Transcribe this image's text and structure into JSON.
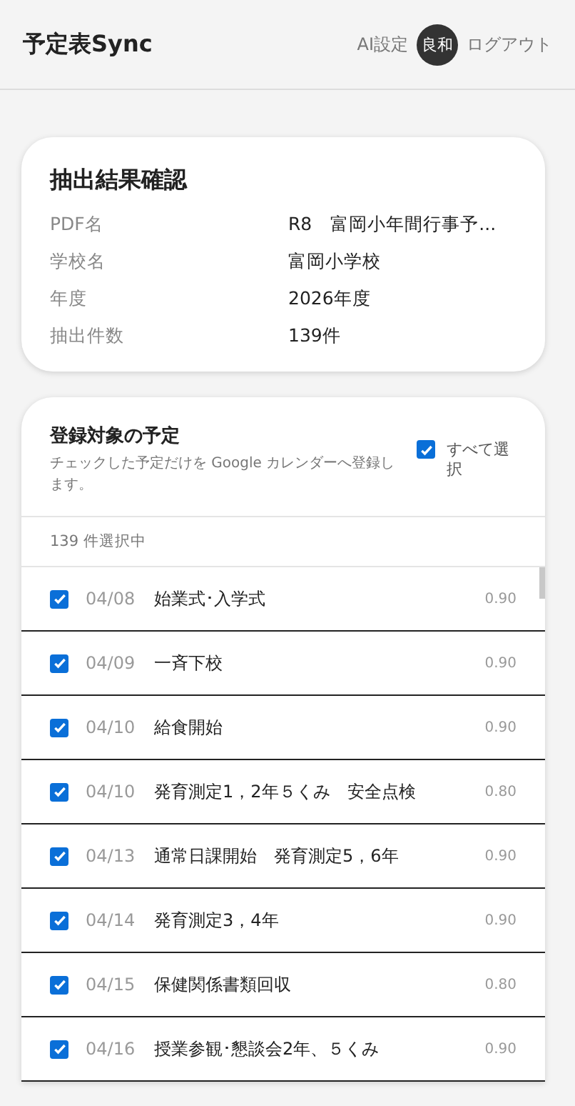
{
  "header": {
    "title": "予定表Sync",
    "ai_settings": "AI設定",
    "avatar": "良和",
    "logout": "ログアウト"
  },
  "summary": {
    "title": "抽出結果確認",
    "fields": [
      {
        "label": "PDF名",
        "value": "R8　富岡小年間行事予..."
      },
      {
        "label": "学校名",
        "value": "富岡小学校"
      },
      {
        "label": "年度",
        "value": "2026年度"
      },
      {
        "label": "抽出件数",
        "value": "139件"
      }
    ]
  },
  "events": {
    "title": "登録対象の予定",
    "description": "チェックした予定だけを Google カレンダーへ登録します。",
    "select_all": {
      "label": "すべて選択",
      "checked": true
    },
    "selected_count": "139 件選択中",
    "rows": [
      {
        "date": "04/08",
        "title": "始業式･入学式",
        "score": "0.90",
        "checked": true
      },
      {
        "date": "04/09",
        "title": "一斉下校",
        "score": "0.90",
        "checked": true
      },
      {
        "date": "04/10",
        "title": "給食開始",
        "score": "0.90",
        "checked": true
      },
      {
        "date": "04/10",
        "title": "発育測定1，2年５くみ　安全点検",
        "score": "0.80",
        "checked": true
      },
      {
        "date": "04/13",
        "title": "通常日課開始　発育測定5，6年",
        "score": "0.90",
        "checked": true
      },
      {
        "date": "04/14",
        "title": "発育測定3，4年",
        "score": "0.90",
        "checked": true
      },
      {
        "date": "04/15",
        "title": "保健関係書類回収",
        "score": "0.80",
        "checked": true
      },
      {
        "date": "04/16",
        "title": "授業参観･懇談会2年、５くみ",
        "score": "0.90",
        "checked": true
      }
    ]
  }
}
